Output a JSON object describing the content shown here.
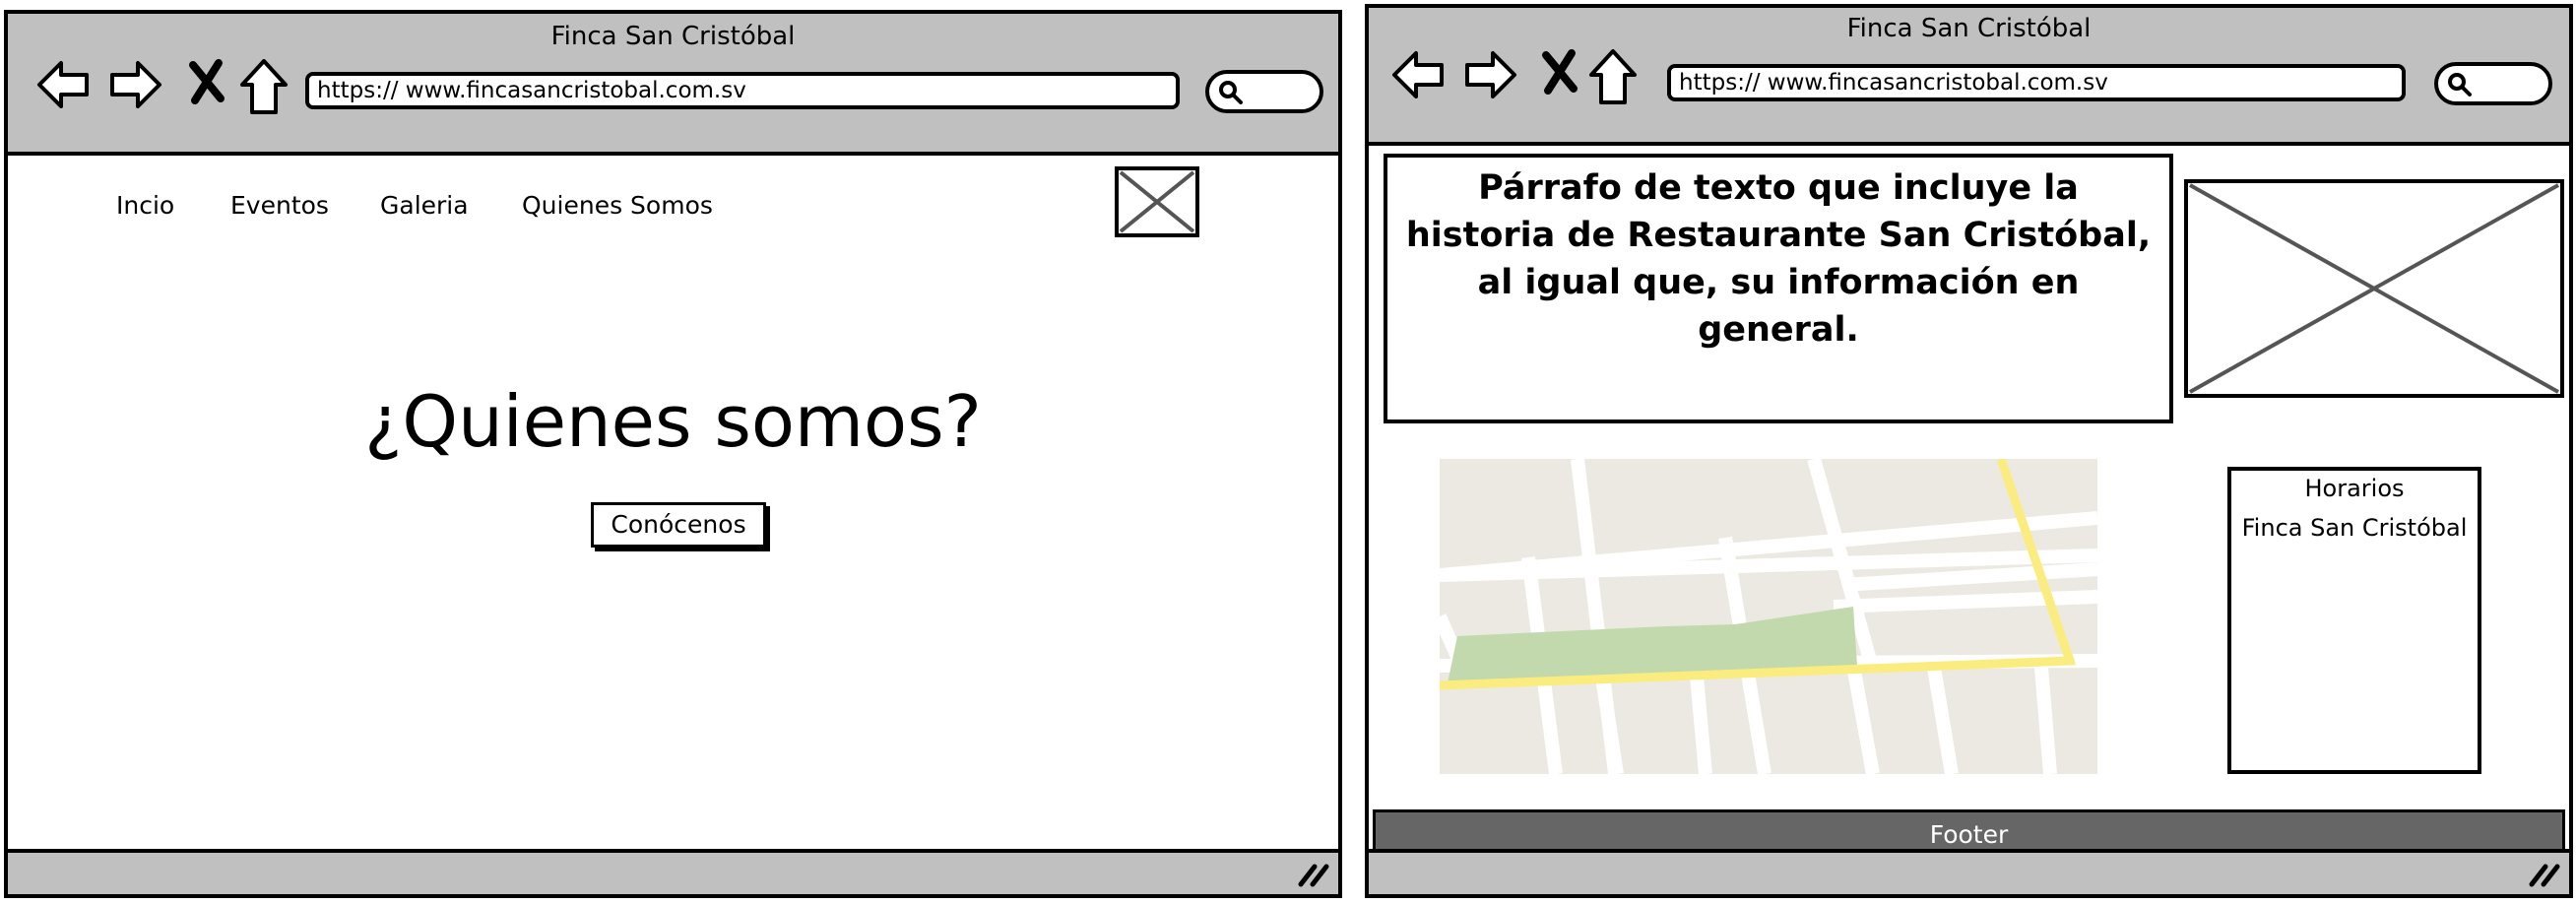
{
  "colors": {
    "chrome": "#c0c0c0",
    "footer": "#666666",
    "map_land": "#ece9e2",
    "map_park": "#c2d9ad",
    "map_highway": "#fbec7f"
  },
  "left": {
    "window_title": "Finca San Cristóbal",
    "url": "https:// www.fincasancristobal.com.sv",
    "nav": [
      "Incio",
      "Eventos",
      "Galeria",
      "Quienes Somos"
    ],
    "hero_title": "¿Quienes somos?",
    "cta_label": "Conócenos"
  },
  "right": {
    "window_title": "Finca San Cristóbal",
    "url": "https:// www.fincasancristobal.com.sv",
    "paragraph": "Párrafo de texto que incluye la historia de Restaurante San Cristóbal, al igual que, su información en general.",
    "hours_title": "Horarios",
    "hours_name": "Finca San Cristóbal",
    "footer": "Footer"
  },
  "icons": [
    "back-arrow-icon",
    "forward-arrow-icon",
    "close-x-icon",
    "home-icon",
    "search-icon",
    "resize-grip-icon",
    "image-placeholder-icon",
    "map-image"
  ]
}
